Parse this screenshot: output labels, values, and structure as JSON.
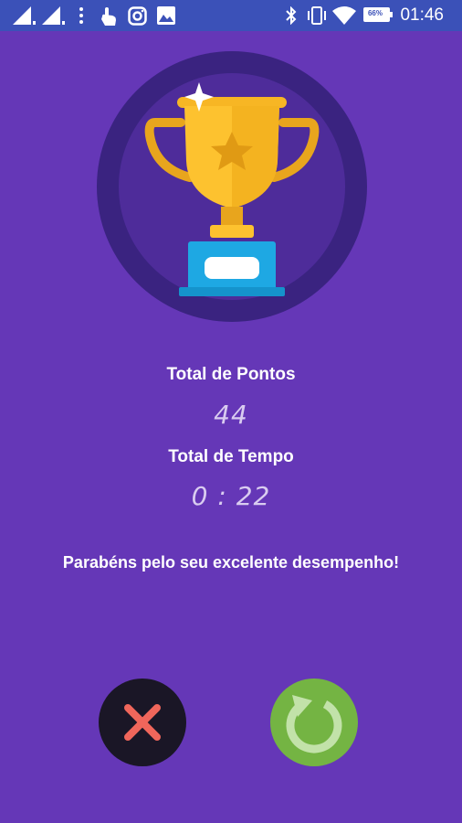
{
  "status_bar": {
    "time": "01:46",
    "battery_percent": "66%",
    "icons": [
      "signal-1-icon",
      "signal-2-icon",
      "menu-dots-icon",
      "touch-icon",
      "instagram-icon",
      "gallery-icon",
      "bluetooth-icon",
      "vibrate-icon",
      "wifi-icon",
      "battery-icon"
    ]
  },
  "results": {
    "points_label": "Total de Pontos",
    "points_value": "44",
    "time_label": "Total de Tempo",
    "time_value": "0 : 22",
    "message": "Parabéns pelo seu excelente desempenho!"
  },
  "buttons": {
    "close_icon": "close-icon",
    "replay_icon": "replay-icon"
  },
  "colors": {
    "background": "#6537b7",
    "status_bar": "#3b51b8",
    "trophy_gold": "#fdc22f",
    "trophy_base": "#1ea8e3",
    "close_button": "#1a1626",
    "close_x": "#f0665b",
    "replay_button": "#74b443",
    "replay_arrow": "#c2e2a9"
  }
}
